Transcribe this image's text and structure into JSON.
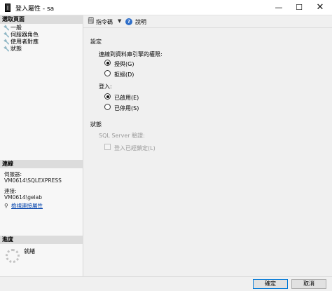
{
  "window": {
    "title": "登入屬性 - sa",
    "minimize_glyph": "—",
    "maximize_glyph": "☐",
    "close_glyph": "✕"
  },
  "sidebar": {
    "select_page_header": "選取頁面",
    "items": [
      {
        "label": "一般",
        "icon": "wrench-icon"
      },
      {
        "label": "伺服器角色",
        "icon": "wrench-icon"
      },
      {
        "label": "使用者對應",
        "icon": "wrench-icon"
      },
      {
        "label": "狀態",
        "icon": "wrench-icon"
      }
    ],
    "connection_header": "連線",
    "server_label": "伺服器:",
    "server_value": "VM0614\\SQLEXPRESS",
    "connection_label": "連接:",
    "connection_value": "VM0614\\gelab",
    "view_connection_link": "檢視連接屬性",
    "progress_header": "進度",
    "progress_status": "就緒"
  },
  "toolbar": {
    "script_label": "指令碼",
    "help_label": "說明"
  },
  "settings": {
    "section_label": "設定",
    "permission_label": "連線到資料庫引擎的權限:",
    "grant_label": "授與(G)",
    "deny_label": "拒絕(D)",
    "login_label": "登入:",
    "enabled_label": "已啟用(E)",
    "disabled_label": "已停用(S)"
  },
  "status": {
    "section_label": "狀態",
    "sql_auth_label": "SQL Server 驗證:",
    "locked_out_label": "登入已經鎖定(L)"
  },
  "footer": {
    "ok_label": "確定",
    "cancel_label": "取消"
  }
}
